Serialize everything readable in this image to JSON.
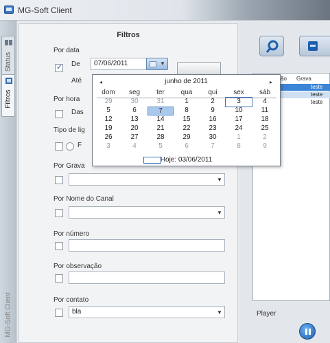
{
  "window": {
    "title": "MG-Soft Client"
  },
  "tabs": {
    "status": "Status",
    "filtros": "Filtros",
    "client": "MG-Soft Client"
  },
  "panel": {
    "title": "Filtros",
    "por_data": {
      "label": "Por data",
      "de_label": "De",
      "de_value": "07/06/2011",
      "ate_label": "Até",
      "de_checked": true
    },
    "por_hora": {
      "label": "Por hora",
      "das_label": "Das"
    },
    "tipo": {
      "label": "Tipo de lig",
      "f_label": "F"
    },
    "por_gravacao": {
      "label": "Por Grava"
    },
    "por_nome_canal": {
      "label": "Por Nome do Canal"
    },
    "por_numero": {
      "label": "Por número"
    },
    "por_observacao": {
      "label": "Por observação"
    },
    "por_contato": {
      "label": "Por contato",
      "value": "bla"
    }
  },
  "calendar": {
    "month_label": "junho de 2011",
    "prev": "◂",
    "next": "▸",
    "weekdays": [
      "dom",
      "seg",
      "ter",
      "qua",
      "qui",
      "sex",
      "sáb"
    ],
    "weeks": [
      [
        "29",
        "30",
        "31",
        "1",
        "2",
        "3",
        "4"
      ],
      [
        "5",
        "6",
        "7",
        "8",
        "9",
        "10",
        "11"
      ],
      [
        "12",
        "13",
        "14",
        "15",
        "16",
        "17",
        "18"
      ],
      [
        "19",
        "20",
        "21",
        "22",
        "23",
        "24",
        "25"
      ],
      [
        "26",
        "27",
        "28",
        "29",
        "30",
        "1",
        "2"
      ],
      [
        "3",
        "4",
        "5",
        "6",
        "7",
        "8",
        "9"
      ]
    ],
    "today_label": "Hoje: 03/06/2011"
  },
  "right": {
    "grid_headers": [
      "ão",
      "Grava"
    ],
    "grid_rows": [
      "teste",
      "teste",
      "teste"
    ],
    "player_label": "Player"
  },
  "colors": {
    "selection_blue": "#a9c8ec",
    "accent": "#1d5fae"
  }
}
